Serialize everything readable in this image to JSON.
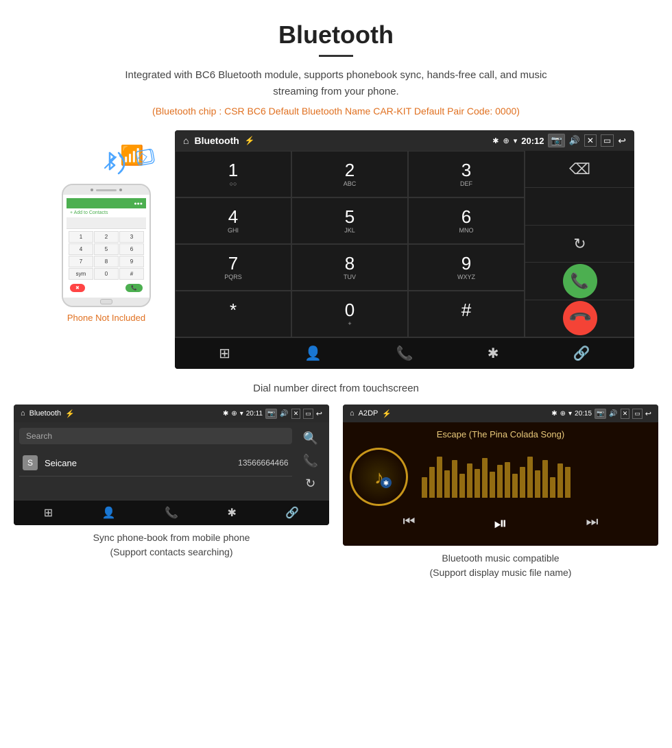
{
  "header": {
    "title": "Bluetooth",
    "subtitle": "Integrated with BC6 Bluetooth module, supports phonebook sync, hands-free call, and music streaming from your phone.",
    "info_line": "(Bluetooth chip : CSR BC6    Default Bluetooth Name CAR-KIT    Default Pair Code: 0000)"
  },
  "phone_label": "Phone Not Included",
  "car_screen": {
    "status_bar": {
      "title": "Bluetooth",
      "time": "20:12"
    },
    "dial_keys": [
      {
        "main": "1",
        "sub": "○○"
      },
      {
        "main": "2",
        "sub": "ABC"
      },
      {
        "main": "3",
        "sub": "DEF"
      },
      {
        "main": "4",
        "sub": "GHI"
      },
      {
        "main": "5",
        "sub": "JKL"
      },
      {
        "main": "6",
        "sub": "MNO"
      },
      {
        "main": "7",
        "sub": "PQRS"
      },
      {
        "main": "8",
        "sub": "TUV"
      },
      {
        "main": "9",
        "sub": "WXYZ"
      },
      {
        "main": "*",
        "sub": ""
      },
      {
        "main": "0",
        "sub": "+"
      },
      {
        "main": "#",
        "sub": ""
      }
    ]
  },
  "dial_caption": "Dial number direct from touchscreen",
  "phonebook_screen": {
    "status_bar": {
      "title": "Bluetooth",
      "time": "20:11"
    },
    "search_placeholder": "Search",
    "contact": {
      "letter": "S",
      "name": "Seicane",
      "number": "13566664466"
    }
  },
  "phonebook_caption": "Sync phone-book from mobile phone\n(Support contacts searching)",
  "music_screen": {
    "status_bar": {
      "title": "A2DP",
      "time": "20:15"
    },
    "song_title": "Escape (The Pina Colada Song)"
  },
  "music_caption": "Bluetooth music compatible\n(Support display music file name)",
  "eq_bars": [
    30,
    45,
    60,
    40,
    55,
    35,
    50,
    42,
    58,
    38,
    48,
    52,
    35,
    45,
    60,
    40,
    55,
    30,
    50,
    45
  ]
}
